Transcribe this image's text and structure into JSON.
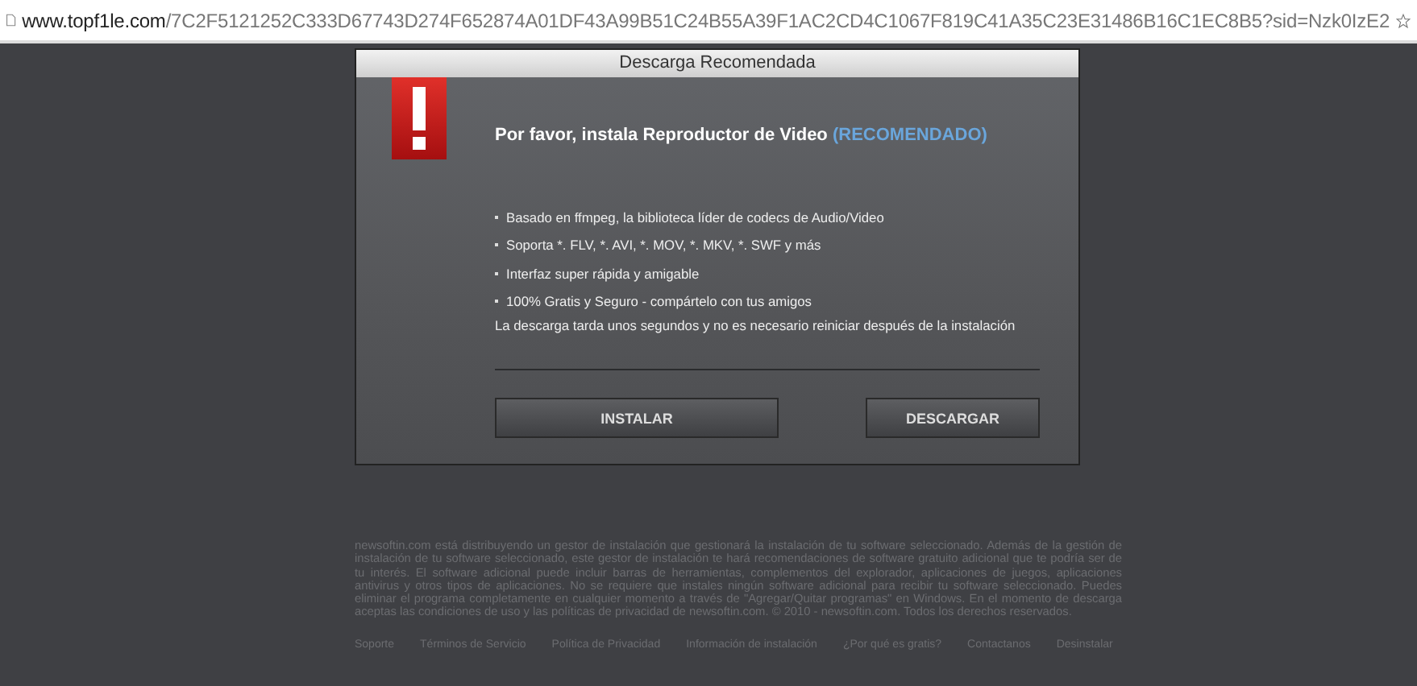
{
  "address_bar": {
    "domain": "www.topf1le.com",
    "path": "/7C2F5121252C333D67743D274F652874A01DF43A99B51C24B55A39F1AC2CD4C1067F819C41A35C23E31486B16C1EC8B5?sid=Nzk0IzE2"
  },
  "dialog": {
    "title": "Descarga Recomendada",
    "heading": "Por favor, instala Reproductor de Video",
    "heading_tag": "(RECOMENDADO)",
    "features": [
      "Basado en ffmpeg, la biblioteca líder de codecs de Audio/Video",
      "Soporta *. FLV, *. AVI, *. MOV, *. MKV, *. SWF y más",
      "Interfaz super rápida y amigable",
      "100% Gratis y Seguro - compártelo con tus amigos"
    ],
    "note": "La descarga tarda unos segundos y no es necesario reiniciar después de la instalación",
    "buttons": [
      "INSTALAR",
      "DESCARGAR"
    ]
  },
  "footer": {
    "disclaimer": "newsoftin.com está distribuyendo un gestor de instalación que gestionará la instalación de tu software seleccionado. Además de la gestión de instalación de tu software seleccionado, este gestor de instalación te hará recomendaciones de software gratuito adicional que te podría ser de tu interés. El software adicional puede incluir barras de herramientas, complementos del explorador, aplicaciones de juegos, aplicaciones antivirus y otros tipos de aplicaciones. No se requiere que instales ningún software adicional para recibir tu software seleccionado. Puedes eliminar el programa completamente en cualquier momento a través de \"Agregar/Quitar programas\" en Windows. En el momento de descarga aceptas las condiciones de uso y las políticas de privacidad de newsoftin.com. © 2010 - newsoftin.com. Todos los derechos reservados.",
    "links": [
      "Soporte",
      "Términos de Servicio",
      "Política de Privacidad",
      "Información de instalación",
      "¿Por qué es gratis?",
      "Contactanos",
      "Desinstalar"
    ]
  }
}
